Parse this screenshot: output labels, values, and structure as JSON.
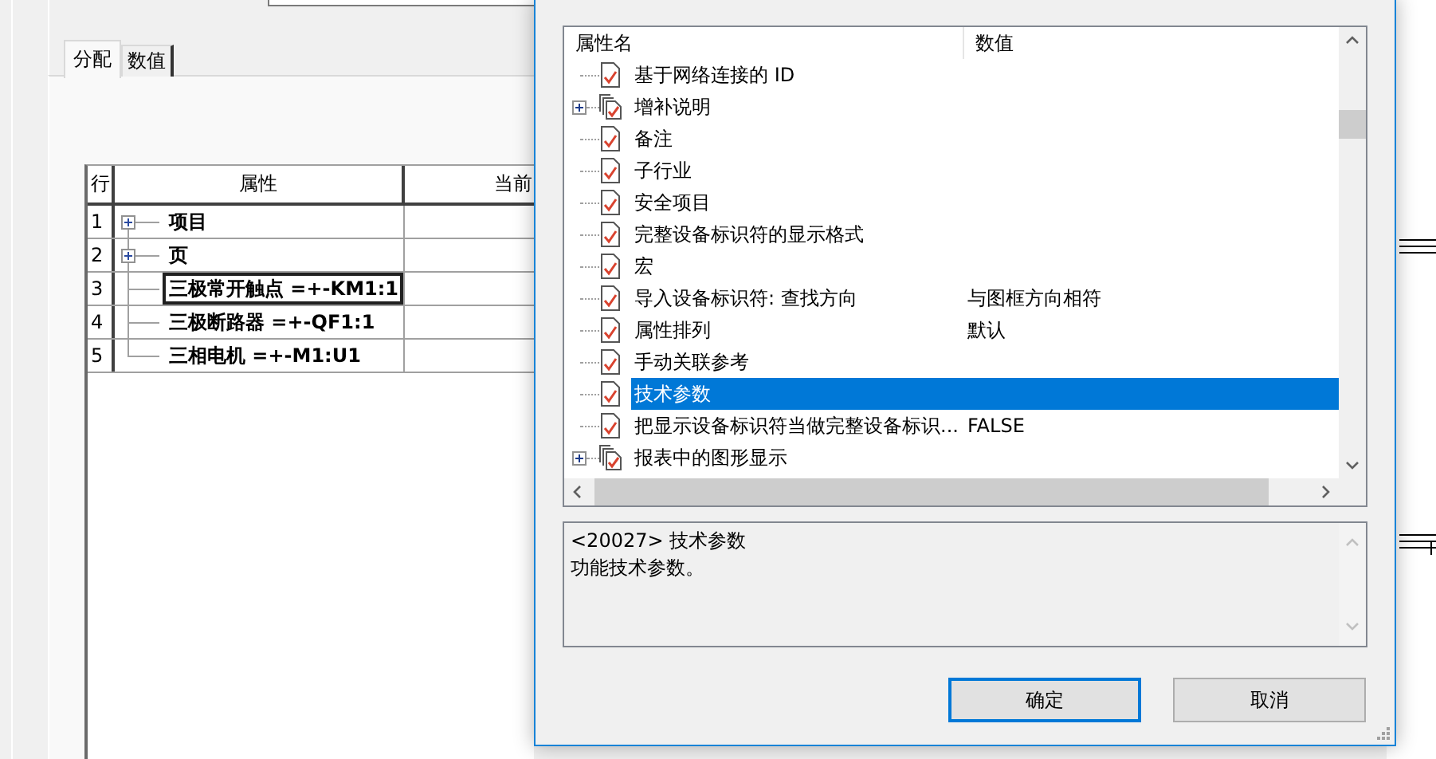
{
  "background_window": {
    "tabs": [
      {
        "label": "分配",
        "selected": true
      },
      {
        "label": "数值",
        "selected": false
      }
    ],
    "table": {
      "columns": [
        "行",
        "属性",
        "当前"
      ],
      "rows": [
        {
          "row": "1",
          "property": "项目",
          "kind": "group",
          "expanded": false,
          "focused": false
        },
        {
          "row": "2",
          "property": "页",
          "kind": "group",
          "expanded": false,
          "focused": false
        },
        {
          "row": "3",
          "property": "三极常开触点 =+-KM1:1",
          "kind": "leaf",
          "focused": true
        },
        {
          "row": "4",
          "property": "三极断路器 =+-QF1:1",
          "kind": "leaf",
          "focused": false
        },
        {
          "row": "5",
          "property": "三相电机 =+-M1:U1",
          "kind": "leaf",
          "focused": false
        }
      ]
    }
  },
  "dialog": {
    "property_list": {
      "columns": [
        "属性名",
        "数值"
      ],
      "items": [
        {
          "name": "基于网络连接的 ID",
          "kind": "property",
          "selected": false
        },
        {
          "name": "增补说明",
          "kind": "group",
          "expanded": false,
          "selected": false
        },
        {
          "name": "备注",
          "kind": "property",
          "selected": false
        },
        {
          "name": "子行业",
          "kind": "property",
          "selected": false
        },
        {
          "name": "安全项目",
          "kind": "property",
          "selected": false
        },
        {
          "name": "完整设备标识符的显示格式",
          "kind": "property",
          "selected": false
        },
        {
          "name": "宏",
          "kind": "property",
          "selected": false
        },
        {
          "name": "导入设备标识符: 查找方向",
          "value": "与图框方向相符",
          "kind": "property",
          "selected": false
        },
        {
          "name": "属性排列",
          "value": "默认",
          "kind": "property",
          "selected": false
        },
        {
          "name": "手动关联参考",
          "kind": "property",
          "selected": false
        },
        {
          "name": "技术参数",
          "kind": "property",
          "selected": true
        },
        {
          "name": "把显示设备标识符当做完整设备标识...",
          "value": "FALSE",
          "kind": "property",
          "selected": false
        },
        {
          "name": "报表中的图形显示",
          "kind": "group",
          "expanded": false,
          "selected": false
        }
      ]
    },
    "description": {
      "lines": [
        "<20027> 技术参数",
        "功能技术参数。"
      ]
    },
    "buttons": [
      {
        "label": "确定",
        "default": true
      },
      {
        "label": "取消",
        "default": false
      }
    ]
  }
}
